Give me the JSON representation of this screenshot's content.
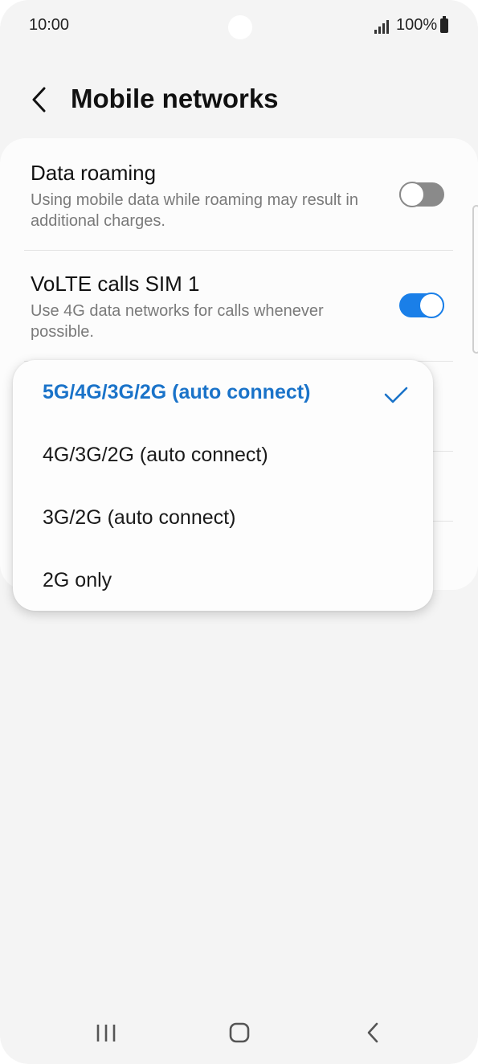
{
  "status_bar": {
    "time": "10:00",
    "battery": "100%",
    "icons": [
      "signal-icon",
      "battery-icon"
    ]
  },
  "header": {
    "title": "Mobile networks",
    "back_icon": "chevron-left-icon"
  },
  "settings": [
    {
      "label": "Data roaming",
      "description": "Using mobile data while roaming may result in additional charges.",
      "toggle": "off"
    },
    {
      "label": "VoLTE calls SIM 1",
      "description": "Use 4G data networks for calls whenever possible.",
      "toggle": "on"
    }
  ],
  "network_mode_menu": {
    "options": [
      "5G/4G/3G/2G (auto connect)",
      "4G/3G/2G (auto connect)",
      "3G/2G (auto connect)",
      "2G only"
    ],
    "selected": "5G/4G/3G/2G (auto connect)",
    "selected_icon": "check-icon"
  },
  "nav_bar": {
    "icons": [
      "recent-apps-icon",
      "home-icon",
      "back-icon"
    ]
  },
  "colors": {
    "accent": "#1a7fe8",
    "selected_text": "#1a73c9",
    "toggle_off": "#8a8a8a",
    "background": "#f4f4f4"
  }
}
